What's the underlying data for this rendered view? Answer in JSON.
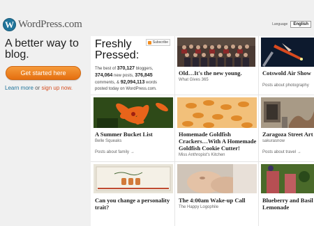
{
  "brand": {
    "mark": "W",
    "name": "WordPress.com"
  },
  "tagline": "A better way to blog.",
  "cta_label": "Get started here",
  "learn_more": {
    "learn": "Learn more",
    "or": " or ",
    "signup": "sign up now."
  },
  "language": {
    "label": "Language",
    "selected": "English"
  },
  "freshly_pressed": {
    "title": "Freshly Pressed:",
    "subscribe_label": "Subscribe",
    "stats_intro": "The best of",
    "bloggers_count": "370,127",
    "bloggers_label": "bloggers,",
    "posts_count": "374,064",
    "posts_label": "new posts,",
    "comments_count": "376,845",
    "comments_label": "comments, &",
    "words_count": "92,094,113",
    "words_label": "words posted today on WordPress.com."
  },
  "posts": [
    {
      "title": "Old…It's the new young.",
      "author": "What Gives 365",
      "more": ""
    },
    {
      "title": "Cotswold Air Show",
      "author": "",
      "more": "Posts about photography"
    },
    {
      "title": "A Summer Bucket List",
      "author": "Belle Squeaks",
      "more": "Posts about family →"
    },
    {
      "title": "Homemade Goldfish Crackers…With A Homemade Goldfish Cookie Cutter!",
      "title_l1": "Homemade Goldfish",
      "title_l2": "Crackers…With A Homemade",
      "title_l3": "Goldfish Cookie Cutter!",
      "author": "Miss Anthropist's Kitchen",
      "more": ""
    },
    {
      "title": "Zaragoza Street Art",
      "author": "sakurasnow",
      "more": "Posts about travel →"
    },
    {
      "title": "Can you change a personality trait?",
      "title_l1": "Can you change a personality",
      "title_l2": "trait?",
      "author": "",
      "more": ""
    },
    {
      "title": "The 4:00am Wake-up Call",
      "author": "The Happy Logophile",
      "more": ""
    },
    {
      "title": "Blueberry and Basil Lemonade",
      "title_l1": "Blueberry and Basil",
      "title_l2": "Lemonade",
      "author": "",
      "more": ""
    }
  ]
}
